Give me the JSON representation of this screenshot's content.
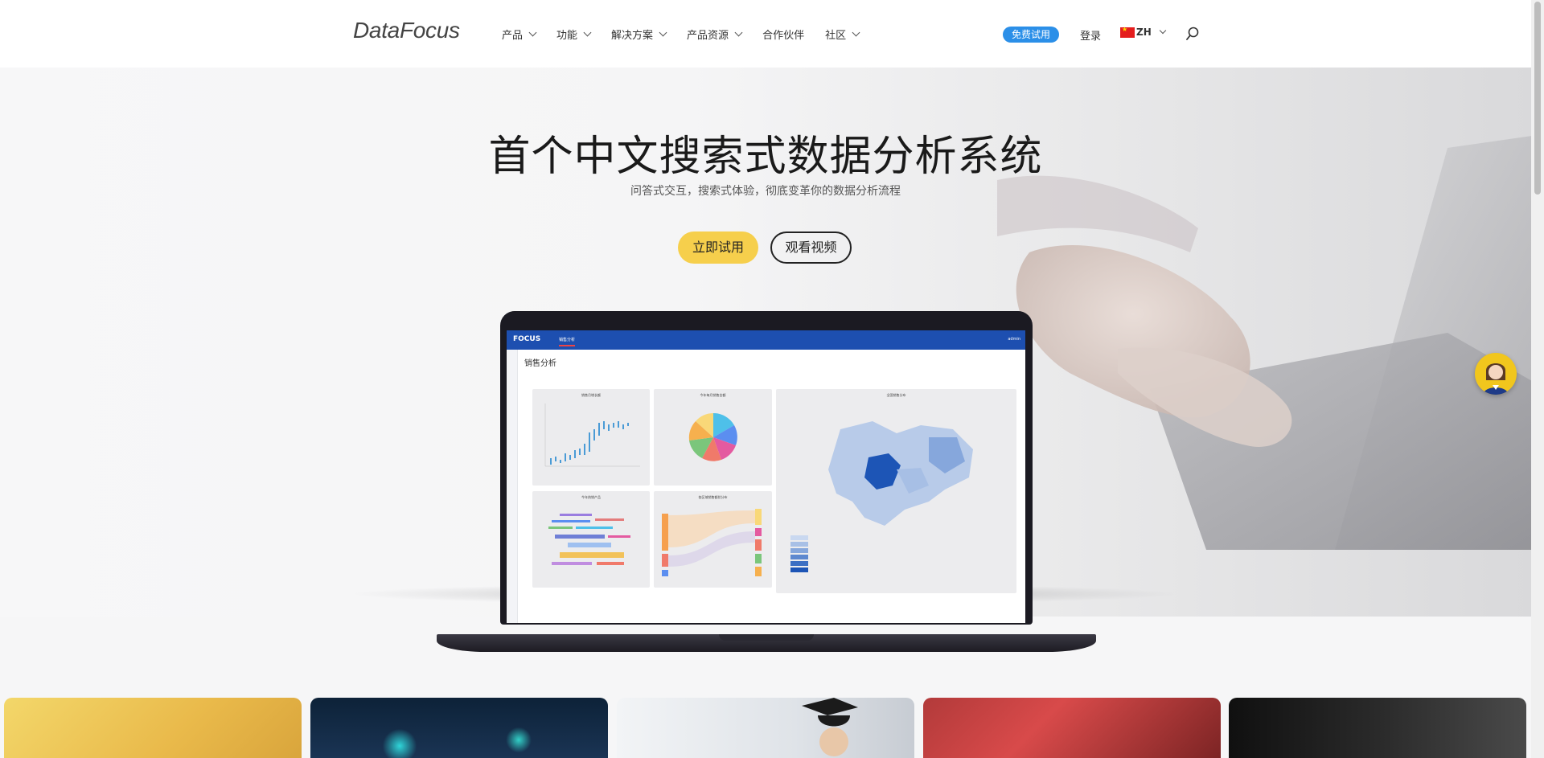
{
  "brand": {
    "logo": "DataFocus"
  },
  "nav": {
    "items": [
      {
        "label": "产品",
        "has_dropdown": true
      },
      {
        "label": "功能",
        "has_dropdown": true
      },
      {
        "label": "解决方案",
        "has_dropdown": true
      },
      {
        "label": "产品资源",
        "has_dropdown": true
      },
      {
        "label": "合作伙伴",
        "has_dropdown": false
      },
      {
        "label": "社区",
        "has_dropdown": true
      }
    ],
    "trial_label": "免费试用",
    "login_label": "登录",
    "language": "ZH",
    "search_icon": "search-icon"
  },
  "hero": {
    "title": "首个中文搜索式数据分析系统",
    "subtitle": "问答式交互，搜索式体验，彻底变革你的数据分析流程",
    "primary_button": "立即试用",
    "secondary_button": "观看视频"
  },
  "mockup": {
    "app_name": "FOCUS",
    "tab": "销售分析",
    "user": "admin",
    "page_title": "销售分析",
    "panels": [
      {
        "title": "销售月增长额"
      },
      {
        "title": "今年每月销售金额"
      },
      {
        "title": "全国销售分布"
      },
      {
        "title": "今年热销产品"
      },
      {
        "title": "各区域销售额状分布"
      }
    ]
  },
  "colors": {
    "accent_yellow": "#f6cf4c",
    "trial_blue": "#2b8fe8",
    "app_bar_blue": "#1d4fb0"
  },
  "assistant": {
    "icon": "customer-service-avatar-icon"
  }
}
